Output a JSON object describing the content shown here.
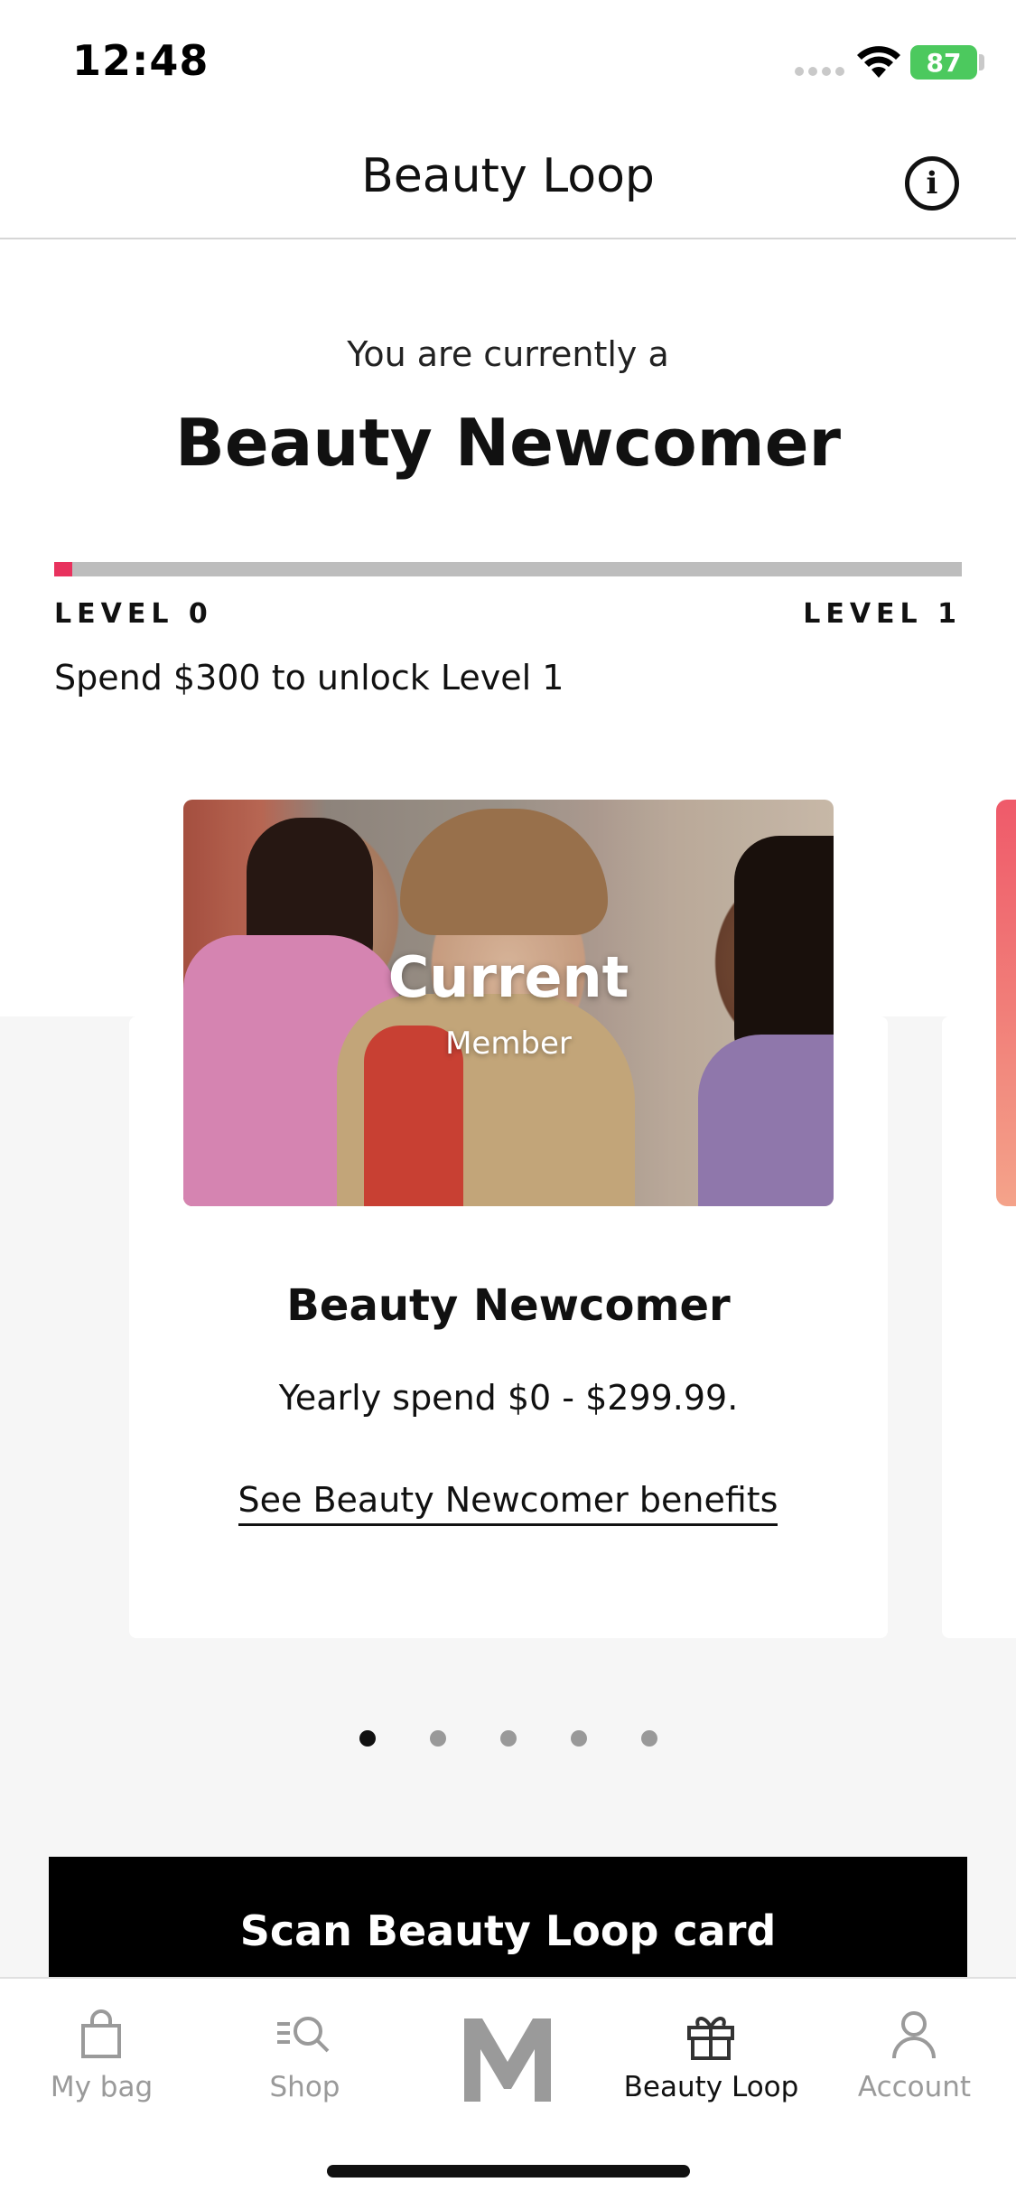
{
  "status_bar": {
    "time": "12:48",
    "battery": "87"
  },
  "header": {
    "title": "Beauty Loop"
  },
  "intro": {
    "lead": "You are currently a",
    "tier": "Beauty Newcomer"
  },
  "progress": {
    "fraction": 0.02,
    "level_start": "LEVEL 0",
    "level_end": "LEVEL 1",
    "unlock_text": "Spend $300 to unlock Level 1",
    "fill_color": "#e8325e"
  },
  "card": {
    "badge_title": "Current",
    "badge_subtitle": "Member",
    "title": "Beauty Newcomer",
    "spend": "Yearly spend $0 - $299.99.",
    "link": "See Beauty Newcomer benefits"
  },
  "carousel": {
    "page_count": 5,
    "active_index": 0
  },
  "scan_button": {
    "label": "Scan Beauty Loop card"
  },
  "tabs": [
    {
      "label": "My bag",
      "icon": "bag-icon"
    },
    {
      "label": "Shop",
      "icon": "search-list-icon"
    },
    {
      "label": "",
      "icon": "m-logo-icon"
    },
    {
      "label": "Beauty Loop",
      "icon": "gift-icon"
    },
    {
      "label": "Account",
      "icon": "person-icon"
    }
  ],
  "colors": {
    "accent": "#e8325e",
    "battery": "#4cc95e",
    "button": "#000000"
  }
}
